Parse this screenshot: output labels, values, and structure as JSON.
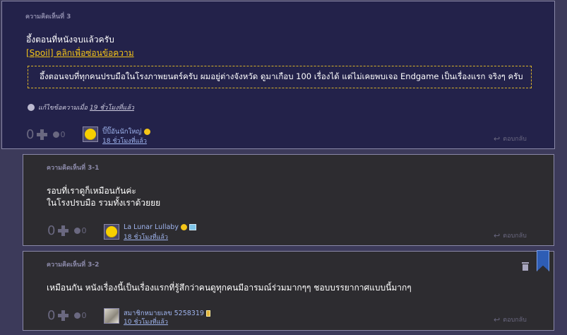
{
  "comment3": {
    "number": "ความคิดเห็นที่ 3",
    "line1": "อึ้งตอนที่หนังจบแล้วครับ",
    "spoiler_link": "[Spoil] คลิกเพื่อซ่อนข้อความ",
    "spoiler_text": "อึ้งตอนจบที่ทุกคนปรบมือในโรงภาพยนตร์ครับ ผมอยู่ต่างจังหวัด ดูมาเกือบ 100 เรื่องได้ แต่ไม่เคยพบเจอ Endgame เป็นเรื่องแรก จริงๆ ครับ",
    "edited_label": "แก้ไขข้อความเมื่อ",
    "edited_ago": "19 ชั่วโมงที่แล้ว",
    "votes": "0",
    "emotions": "0",
    "username": "ปิ๊ปิ๊อันนักใหญ่",
    "time": "18 ชั่วโมงที่แล้ว",
    "reply": "ตอบกลับ"
  },
  "comment3_1": {
    "number": "ความคิดเห็นที่ 3-1",
    "line1": "รอบที่เราดูก็เหมือนกันค่ะ",
    "line2": "ในโรงปรบมือ รวมทั้งเราด้วยยย",
    "votes": "0",
    "emotions": "0",
    "username": "La Lunar Lullaby",
    "time": "18 ชั่วโมงที่แล้ว",
    "reply": "ตอบกลับ"
  },
  "comment3_2": {
    "number": "ความคิดเห็นที่ 3-2",
    "line1": "เหมือนกัน หนังเรื่องนี้เป็นเรื่องแรกที่รู้สึกว่าคนดูทุกคนมีอารมณ์ร่วมมากๆๆ ชอบบรรยากาศแบบนี้มากๆ",
    "votes": "0",
    "emotions": "0",
    "username": "สมาชิกหมายเลข 5258319",
    "time": "10 ชั่วโมงที่แล้ว",
    "reply": "ตอบกลับ"
  },
  "icons": [
    "globe-icon",
    "plus-icon",
    "emotion-icon",
    "smiley-badge-icon",
    "card-badge-icon",
    "gold-badge-icon",
    "reply-arrow-icon",
    "trash-icon",
    "bookmark-icon"
  ]
}
